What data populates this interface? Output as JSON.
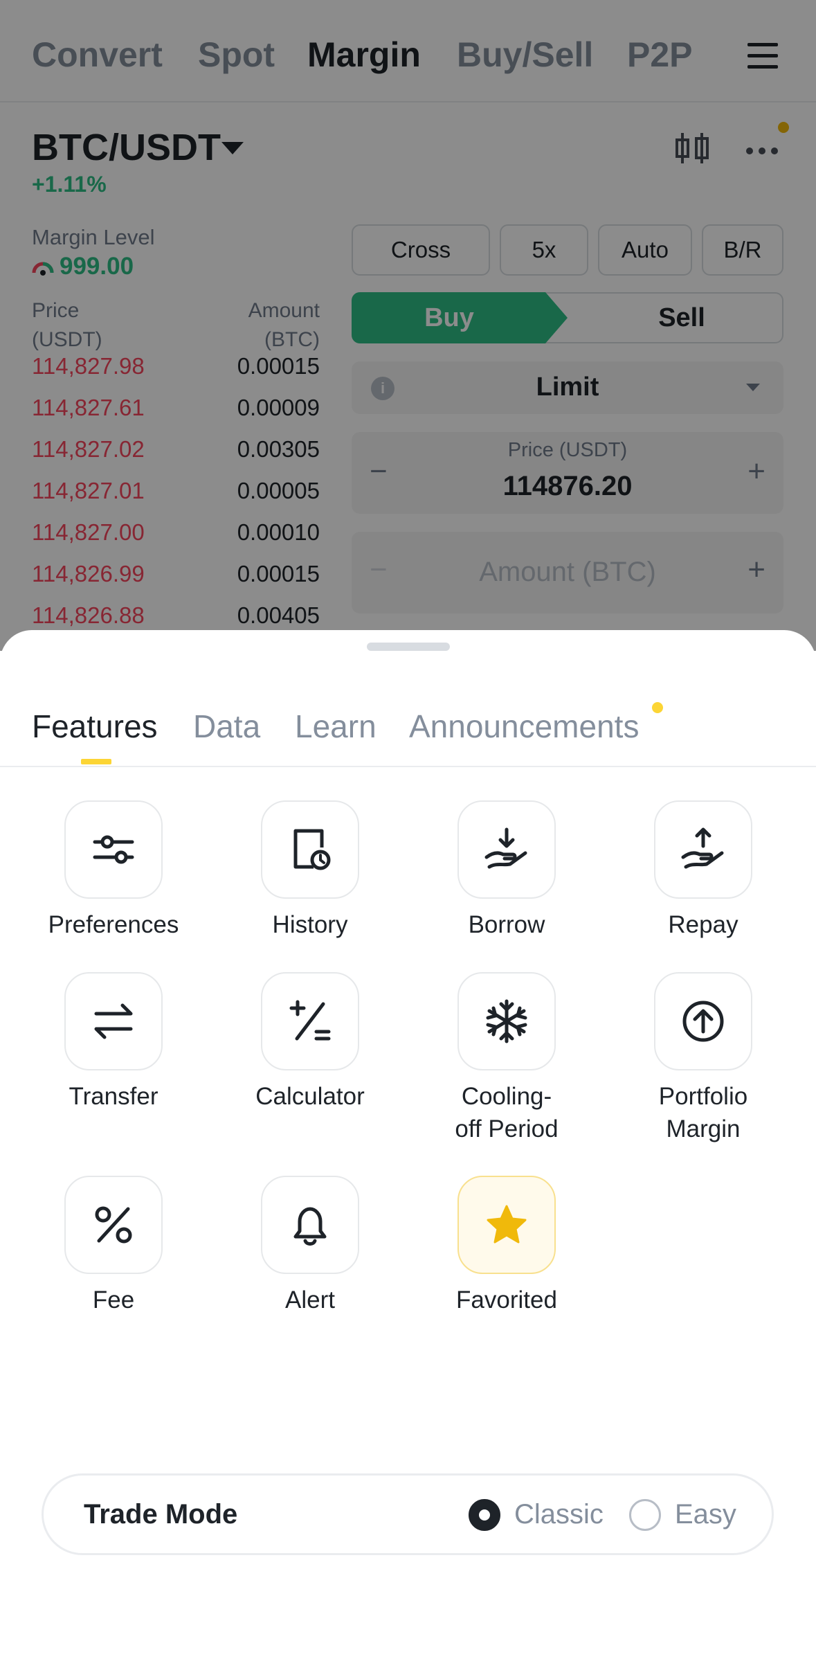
{
  "topnav": {
    "tabs": [
      "Convert",
      "Spot",
      "Margin",
      "Buy/Sell",
      "P2P"
    ],
    "active": "Margin"
  },
  "market": {
    "pair": "BTC/USDT",
    "change": "+1.11%",
    "margin_level_label": "Margin Level",
    "margin_level_value": "999.00"
  },
  "orderbook": {
    "price_header": "Price\n(USDT)",
    "amount_header": "Amount\n(BTC)",
    "rows": [
      {
        "price": "114,827.98",
        "amount": "0.00015"
      },
      {
        "price": "114,827.61",
        "amount": "0.00009"
      },
      {
        "price": "114,827.02",
        "amount": "0.00305"
      },
      {
        "price": "114,827.01",
        "amount": "0.00005"
      },
      {
        "price": "114,827.00",
        "amount": "0.00010"
      },
      {
        "price": "114,826.99",
        "amount": "0.00015"
      },
      {
        "price": "114,826.88",
        "amount": "0.00405"
      }
    ]
  },
  "order_form": {
    "chips": [
      "Cross",
      "5x",
      "Auto",
      "B/R"
    ],
    "buy_label": "Buy",
    "sell_label": "Sell",
    "order_type": "Limit",
    "info_glyph": "i",
    "price_label": "Price (USDT)",
    "price_value": "114876.20",
    "amount_placeholder": "Amount (BTC)",
    "minus": "−",
    "plus": "+"
  },
  "sheet": {
    "tabs": [
      "Features",
      "Data",
      "Learn",
      "Announcements"
    ],
    "active_tab": "Features",
    "features": [
      {
        "label": "Preferences",
        "icon": "sliders-icon"
      },
      {
        "label": "History",
        "icon": "history-icon"
      },
      {
        "label": "Borrow",
        "icon": "borrow-hand-icon"
      },
      {
        "label": "Repay",
        "icon": "repay-hand-icon"
      },
      {
        "label": "Transfer",
        "icon": "transfer-arrows-icon"
      },
      {
        "label": "Calculator",
        "icon": "calculator-icon"
      },
      {
        "label": "Cooling-\noff Period",
        "icon": "snowflake-icon"
      },
      {
        "label": "Portfolio\nMargin",
        "icon": "arrow-up-circle-icon"
      },
      {
        "label": "Fee",
        "icon": "percent-icon"
      },
      {
        "label": "Alert",
        "icon": "bell-icon"
      },
      {
        "label": "Favorited",
        "icon": "star-icon"
      }
    ],
    "trade_mode": {
      "label": "Trade Mode",
      "options": [
        "Classic",
        "Easy"
      ],
      "selected": "Classic"
    }
  },
  "colors": {
    "buy_green": "#2ebd85",
    "sell_red": "#f6465d",
    "accent_yellow": "#fcd535",
    "star_yellow": "#f0b90b"
  }
}
